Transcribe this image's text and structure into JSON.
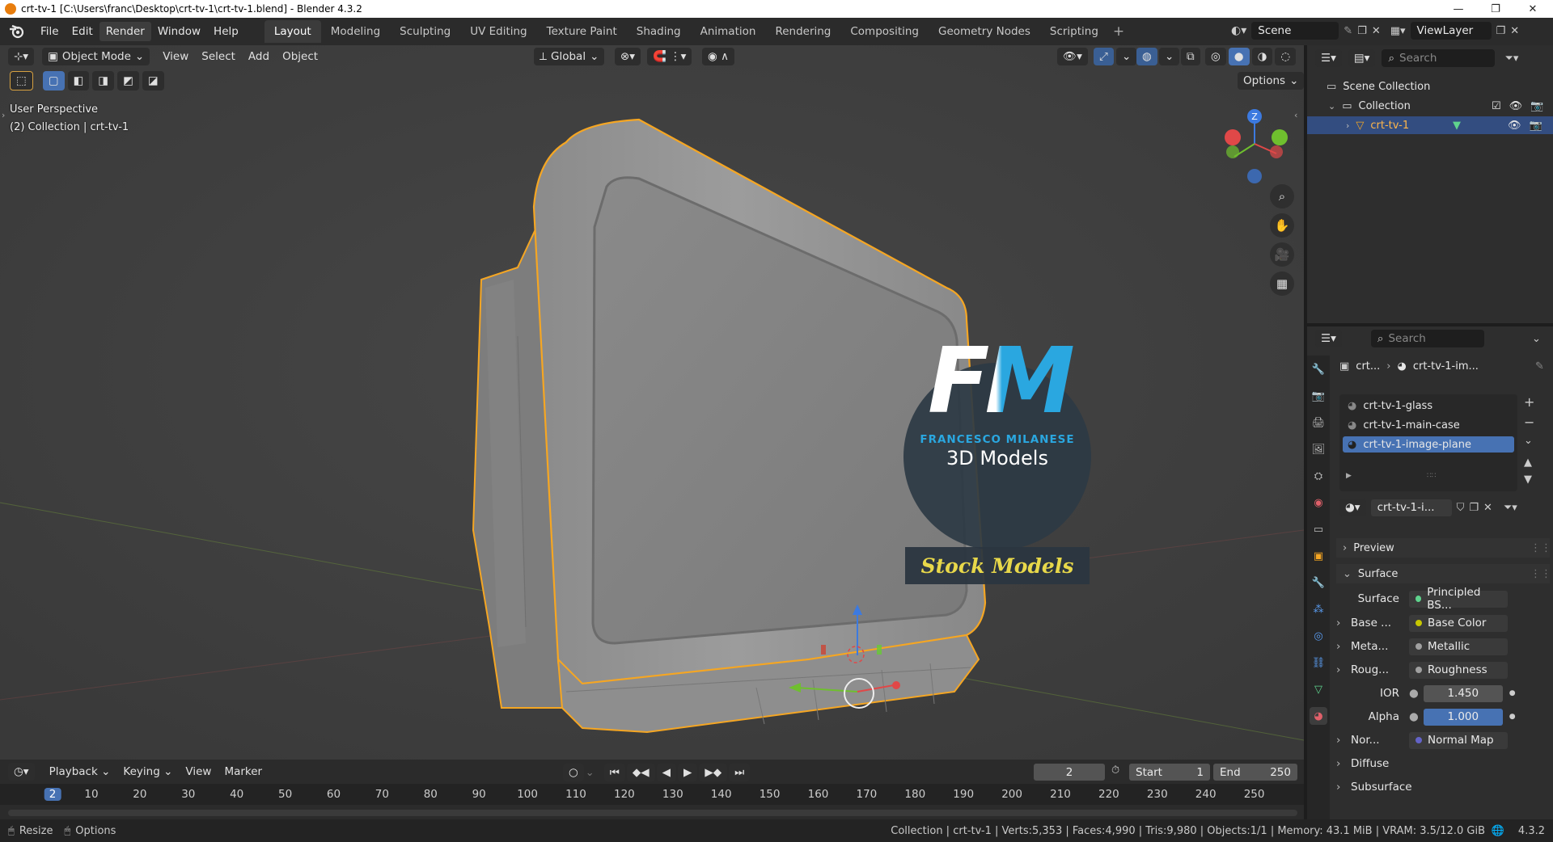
{
  "window": {
    "title": "crt-tv-1 [C:\\Users\\franc\\Desktop\\crt-tv-1\\crt-tv-1.blend] - Blender 4.3.2",
    "minimize": "—",
    "maximize": "❐",
    "close": "✕"
  },
  "menu": [
    "File",
    "Edit",
    "Render",
    "Window",
    "Help"
  ],
  "workspaces": [
    "Layout",
    "Modeling",
    "Sculpting",
    "UV Editing",
    "Texture Paint",
    "Shading",
    "Animation",
    "Rendering",
    "Compositing",
    "Geometry Nodes",
    "Scripting"
  ],
  "scene": {
    "name": "Scene",
    "view_layer": "ViewLayer"
  },
  "viewport": {
    "mode": "Object Mode",
    "menus": [
      "View",
      "Select",
      "Add",
      "Object"
    ],
    "orientation": "Global",
    "options_label": "Options",
    "perspective_text": "User Perspective",
    "collection_text": "(2) Collection | crt-tv-1",
    "gizmo_axes": {
      "z": "Z"
    },
    "logo": {
      "initials": "FM",
      "author": "FRANCESCO MILANESE",
      "subtitle": "3D Models",
      "banner": "Stock Models"
    }
  },
  "outliner": {
    "search_placeholder": "Search",
    "scene_collection": "Scene Collection",
    "collection": "Collection",
    "object": "crt-tv-1"
  },
  "properties": {
    "search_placeholder": "Search",
    "breadcrumb": [
      "crt...",
      "crt-tv-1-im..."
    ],
    "materials": [
      "crt-tv-1-glass",
      "crt-tv-1-main-case",
      "crt-tv-1-image-plane"
    ],
    "selected_material_index": 2,
    "material_field": "crt-tv-1-i...",
    "panels": {
      "preview": "Preview",
      "surface": "Surface"
    },
    "surface": {
      "surface_label": "Surface",
      "surface_value": "Principled BS...",
      "rows": [
        {
          "label": "Base ...",
          "value": "Base Color"
        },
        {
          "label": "Meta...",
          "value": "Metallic"
        },
        {
          "label": "Roug...",
          "value": "Roughness"
        }
      ],
      "ior_label": "IOR",
      "ior_value": "1.450",
      "alpha_label": "Alpha",
      "alpha_value": "1.000",
      "normal_label": "Nor...",
      "normal_value": "Normal Map",
      "diffuse": "Diffuse",
      "subsurface": "Subsurface"
    }
  },
  "timeline": {
    "menus": [
      "Playback",
      "Keying",
      "View",
      "Marker"
    ],
    "current_frame": "2",
    "start_label": "Start",
    "start_value": "1",
    "end_label": "End",
    "end_value": "250",
    "ruler": [
      "2",
      "10",
      "20",
      "30",
      "40",
      "50",
      "60",
      "70",
      "80",
      "90",
      "100",
      "110",
      "120",
      "130",
      "140",
      "150",
      "160",
      "170",
      "180",
      "190",
      "200",
      "210",
      "220",
      "230",
      "240",
      "250"
    ]
  },
  "status": {
    "resize": "Resize",
    "options": "Options",
    "info": "Collection | crt-tv-1 | Verts:5,353 | Faces:4,990 | Tris:9,980 | Objects:1/1 | Memory: 43.1 MiB | VRAM: 3.5/12.0 GiB",
    "version": "4.3.2"
  },
  "colors": {
    "accent_blue": "#4772b3",
    "selection_orange": "#f5a623",
    "viewport_bg": "#3e3e3e"
  }
}
